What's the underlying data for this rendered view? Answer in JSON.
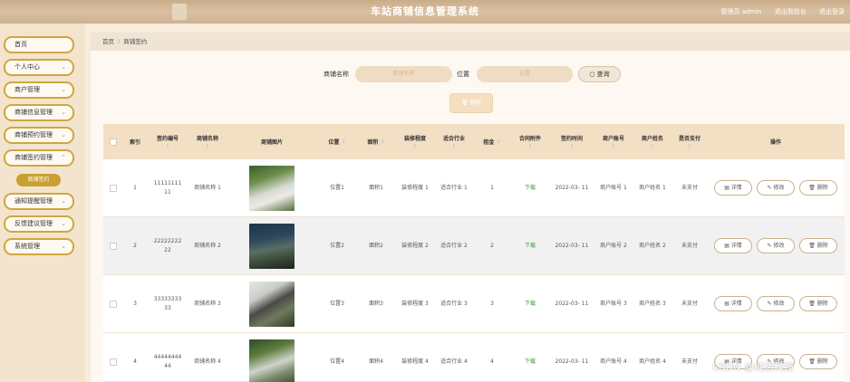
{
  "header": {
    "title": "车站商铺信息管理系统",
    "links": [
      "管理员 admin",
      "退出到前台",
      "退出登录"
    ]
  },
  "sidebar": {
    "items": [
      {
        "label": "首页",
        "chevron": false
      },
      {
        "label": "个人中心",
        "chevron": true
      },
      {
        "label": "商户管理",
        "chevron": true
      },
      {
        "label": "商铺信息管理",
        "chevron": true
      },
      {
        "label": "商铺预约管理",
        "chevron": true
      },
      {
        "label": "商铺签约管理",
        "chevron": true
      },
      {
        "label": "通知提醒管理",
        "chevron": true
      },
      {
        "label": "反馈建议管理",
        "chevron": true
      },
      {
        "label": "系统管理",
        "chevron": true
      }
    ],
    "active_sub": "商铺签约"
  },
  "breadcrumb": {
    "home": "首页",
    "current": "商铺签约"
  },
  "search": {
    "name_label": "商铺名称",
    "name_placeholder": "商铺名称",
    "loc_label": "位置",
    "loc_placeholder": "位置",
    "query_label": "查询",
    "delete_label": "删除"
  },
  "table": {
    "headers": [
      "索引",
      "签约编号",
      "商铺名称",
      "商铺图片",
      "位置",
      "面积",
      "装修程度",
      "适合行业",
      "租金",
      "合同附件",
      "签约时间",
      "商户账号",
      "商户姓名",
      "是否支付",
      "操作"
    ],
    "rows": [
      {
        "index": "1",
        "code": "11111111 11",
        "name": "商铺名称 1",
        "loc": "位置1",
        "area": "面积1",
        "decor": "装修程度 1",
        "industry": "适合行业 1",
        "rent": "1",
        "attach": "下载",
        "time": "2022-03- 11",
        "account": "商户账号 1",
        "merchant": "商户姓名 1",
        "paid": "未支付"
      },
      {
        "index": "2",
        "code": "22222222 22",
        "name": "商铺名称 2",
        "loc": "位置2",
        "area": "面积2",
        "decor": "装修程度 2",
        "industry": "适合行业 2",
        "rent": "2",
        "attach": "下载",
        "time": "2022-03- 11",
        "account": "商户账号 2",
        "merchant": "商户姓名 2",
        "paid": "未支付"
      },
      {
        "index": "3",
        "code": "33333333 33",
        "name": "商铺名称 3",
        "loc": "位置3",
        "area": "面积3",
        "decor": "装修程度 3",
        "industry": "适合行业 3",
        "rent": "3",
        "attach": "下载",
        "time": "2022-03- 11",
        "account": "商户账号 3",
        "merchant": "商户姓名 3",
        "paid": "未支付"
      },
      {
        "index": "4",
        "code": "44444444 44",
        "name": "商铺名称 4",
        "loc": "位置4",
        "area": "面积4",
        "decor": "装修程度 4",
        "industry": "适合行业 4",
        "rent": "4",
        "attach": "下载",
        "time": "2022-03- 11",
        "account": "商户账号 4",
        "merchant": "商户姓名 4",
        "paid": "未支付"
      }
    ],
    "actions": {
      "detail": "详情",
      "edit": "修改",
      "delete": "删除"
    }
  },
  "watermark": "CSDN @纯清科技"
}
